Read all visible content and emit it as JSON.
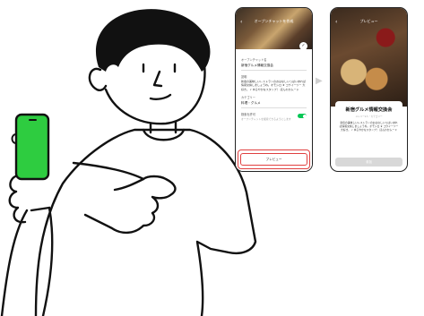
{
  "left_phone": {
    "header_title": "オープンチャットを作成",
    "name_label": "オープンチャット名",
    "name_value": "新宿グルメ情報交換会",
    "desc_label": "説明",
    "desc_text": "新宿の美味しいレストランのおはなしいっぱいあれば情報交換しましょうね。オモシロ ★ コウイーツー 大好き。 ♪ ゆるやかなスタンプ！ ほんわかムード",
    "category_label": "カテゴリー",
    "category_value": "料理・グルメ",
    "search_label": "検索を許可",
    "search_hint": "オープンチャットを検索できるようにします",
    "preview_button": "プレビュー"
  },
  "right_phone": {
    "header_title": "プレビュー",
    "card_title": "新宿グルメ情報交換会",
    "card_sub": "メンバー1人・カテゴリー",
    "card_desc": "新宿の美味しいレストランのおはなしいっぱいあれば情報交換しましょうね。オモシロ ★ コウイーツー 大好き。 ♪ ゆるやかなスタンプ！ ほんわかムード",
    "join_button": "参加"
  },
  "colors": {
    "highlight": "#e04040",
    "toggle_on": "#06c755",
    "phone_screen": "#2ecc40"
  }
}
